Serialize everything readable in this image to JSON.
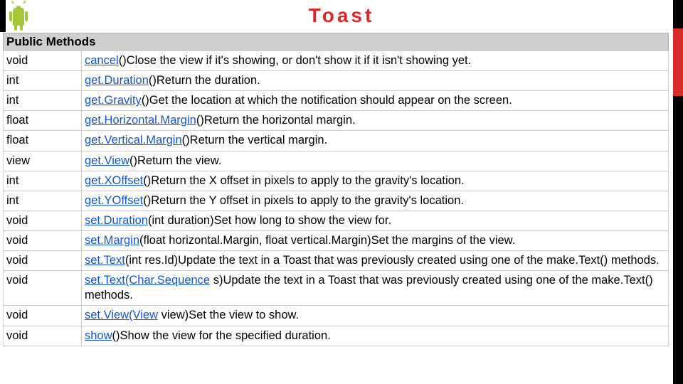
{
  "title": "Toast",
  "section": "Public Methods",
  "methods": [
    {
      "return": "void",
      "name": "cancel",
      "sig": "()",
      "desc": "Close the view if it's showing, or don't show it if it isn't showing yet."
    },
    {
      "return": "int",
      "name": "get.Duration",
      "sig": "()",
      "desc": "Return the duration."
    },
    {
      "return": "int",
      "name": "get.Gravity",
      "sig": "()",
      "desc": "Get the location at which the notification should appear on the screen."
    },
    {
      "return": "float",
      "name": "get.Horizontal.Margin",
      "sig": "()",
      "desc": "Return the horizontal margin."
    },
    {
      "return": "float",
      "name": "get.Vertical.Margin",
      "sig": "()",
      "desc": "Return the vertical margin."
    },
    {
      "return": "view",
      "name": "get.View",
      "sig": "()",
      "desc": "Return the view."
    },
    {
      "return": "int",
      "name": "get.XOffset",
      "sig": "()",
      "desc": "Return the X offset in pixels to apply to the gravity's location."
    },
    {
      "return": "int",
      "name": "get.YOffset",
      "sig": "()",
      "desc": "Return the Y offset in pixels to apply to the gravity's location."
    },
    {
      "return": "void",
      "name": "set.Duration",
      "sig": "(int duration)",
      "desc": "Set how long to show the view for."
    },
    {
      "return": "void",
      "name": "set.Margin",
      "sig": "(float horizontal.Margin, float vertical.Margin)",
      "desc": "Set the margins of the view."
    },
    {
      "return": "void",
      "name": "set.Text",
      "sig": "(int res.Id)",
      "desc": "Update the text in a Toast that was previously created using one of the make.Text() methods."
    },
    {
      "return": "void",
      "name": "set.Text",
      "sig_linked": "(Char.Sequence",
      "sig_rest": " s)",
      "desc": "Update the text in a Toast that was previously created using one of the make.Text() methods."
    },
    {
      "return": "void",
      "name": "set.View",
      "sig_linked": "(View",
      "sig_rest": " view)",
      "desc": "Set the view to show."
    },
    {
      "return": "void",
      "name": "show",
      "sig": "()",
      "desc": "Show the view for the specified duration."
    }
  ]
}
